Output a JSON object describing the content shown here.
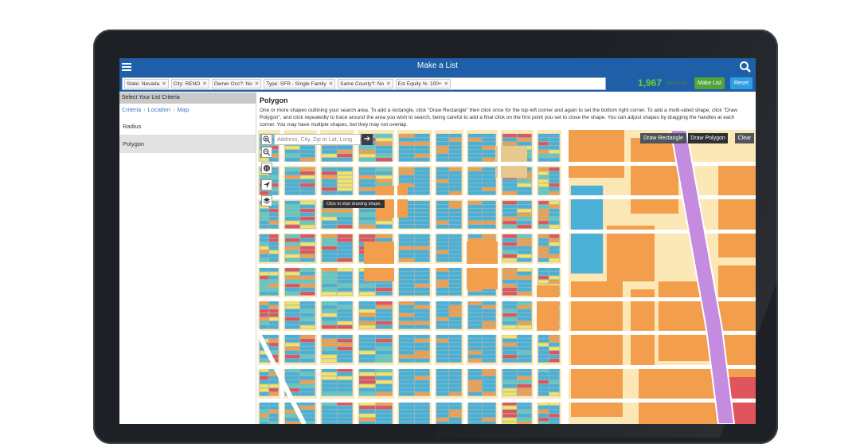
{
  "app": {
    "title": "Make a List"
  },
  "filters": [
    {
      "label": "State: Nevada"
    },
    {
      "label": "City: RENO"
    },
    {
      "label": "Owner Occ?: No"
    },
    {
      "label": "Type: SFR - Single Family"
    },
    {
      "label": "Same County?: No"
    },
    {
      "label": "Est Equity %: 100+"
    }
  ],
  "records": {
    "count": "1,967",
    "label": "Records"
  },
  "buttons": {
    "make_list": "Make List",
    "reset": "Reset",
    "draw_rectangle": "Draw Rectangle",
    "draw_polygon": "Draw Polygon",
    "clear": "Clear"
  },
  "sidebar": {
    "header": "Select Your List Criteria",
    "breadcrumbs": [
      "Criteria",
      "Location",
      "Map"
    ],
    "items": [
      {
        "label": "Radius"
      },
      {
        "label": "Polygon"
      }
    ]
  },
  "polygon": {
    "title": "Polygon",
    "description": "One or more shapes outlining your search area. To add a rectangle, click \"Draw Rectangle\" then click once for the top left corner and again to set the bottom right corner. To add a multi-sided shape, click \"Draw Polygon\", and click repeatedly to trace around the area you wish to search, being careful to add a final click on the first point you set to close the shape. You can adjust shapes by dragging the handles at each corner. You may have multiple shapes, but they may not overlap."
  },
  "map": {
    "search_placeholder": "Address, City, Zip or Lat, Long",
    "tooltip": "Click to start drawing shape.",
    "icons": [
      "zoom-in-icon",
      "zoom-out-icon",
      "globe-icon",
      "locate-arrow-icon",
      "layers-icon"
    ],
    "colors": {
      "background": "#fce8b6",
      "orange": "#f29e4c",
      "blue": "#4ab0d6",
      "teal": "#65c8c0",
      "yellow": "#f3e36a",
      "red": "#e0555b",
      "highway": "#c58be0"
    }
  },
  "theme": {
    "topbar": "#1f5fa8",
    "accent_green": "#52a43a",
    "accent_blue": "#2f9de1",
    "records_green": "#6ec843"
  }
}
